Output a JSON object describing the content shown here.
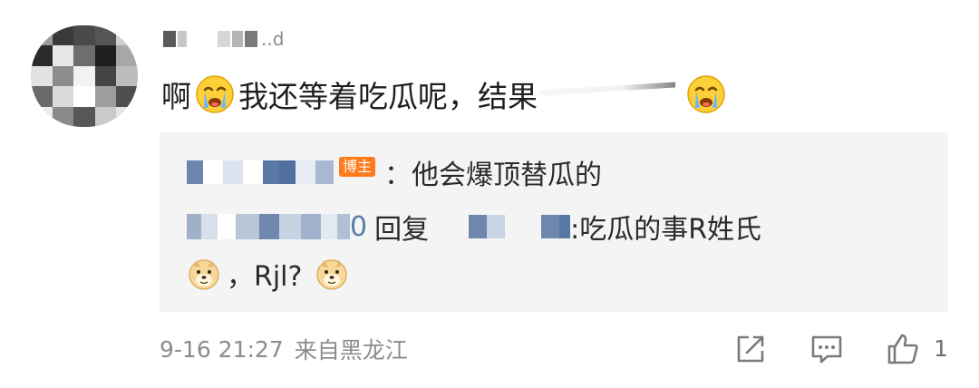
{
  "comment": {
    "username_suffix": "..d",
    "text_prefix": "啊",
    "text_main": "我还等着吃瓜呢，结果",
    "emoji_icon": "crying-face-icon"
  },
  "reply_preview": {
    "badge": "博主",
    "line1_text": "：他会爆顶替瓜的",
    "line2_digit": "0",
    "line2_reply_word": "回复",
    "line2_text": ":吃瓜的事R姓氏",
    "line3_text": "，Rjl?",
    "emoji_icon": "doge-icon"
  },
  "footer": {
    "timestamp": "9-16 21:27",
    "location": "来自黑龙江",
    "like_count": "1"
  },
  "colors": {
    "badge_bg": "#ff7a1a",
    "link": "#5a7ca8",
    "reply_bg": "#f4f4f4",
    "meta_text": "#8c8c8c"
  }
}
